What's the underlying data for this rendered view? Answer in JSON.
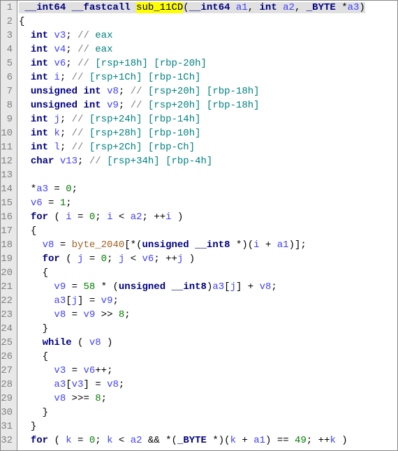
{
  "lines": [
    {
      "num": "1",
      "segments": [
        {
          "cls": "l1-highlight",
          "text": " "
        },
        {
          "cls": "type l1-highlight",
          "text": "__int64"
        },
        {
          "cls": "l1-highlight",
          "text": " "
        },
        {
          "cls": "kw l1-highlight",
          "text": "__fastcall"
        },
        {
          "cls": "l1-highlight",
          "text": " "
        },
        {
          "cls": "func-hl",
          "text": "sub_1"
        },
        {
          "cls": "func-hl",
          "text": "1CD"
        },
        {
          "cls": "paren l1-highlight",
          "text": "("
        },
        {
          "cls": "type l1-highlight",
          "text": "__int64"
        },
        {
          "cls": "l1-highlight",
          "text": " "
        },
        {
          "cls": "var l1-highlight",
          "text": "a1"
        },
        {
          "cls": "paren l1-highlight",
          "text": ", "
        },
        {
          "cls": "type l1-highlight",
          "text": "int"
        },
        {
          "cls": "l1-highlight",
          "text": " "
        },
        {
          "cls": "var l1-highlight",
          "text": "a2"
        },
        {
          "cls": "paren l1-highlight",
          "text": ", "
        },
        {
          "cls": "type l1-highlight",
          "text": "_BYTE"
        },
        {
          "cls": "l1-highlight",
          "text": " *"
        },
        {
          "cls": "var l1-highlight",
          "text": "a3"
        },
        {
          "cls": "paren l1-highlight",
          "text": ")"
        }
      ]
    },
    {
      "num": "2",
      "segments": [
        {
          "cls": "paren",
          "text": "{"
        }
      ]
    },
    {
      "num": "3",
      "segments": [
        {
          "cls": "text",
          "text": "  "
        },
        {
          "cls": "type",
          "text": "int"
        },
        {
          "cls": "text",
          "text": " "
        },
        {
          "cls": "var",
          "text": "v3"
        },
        {
          "cls": "paren",
          "text": "; "
        },
        {
          "cls": "comment",
          "text": "// "
        },
        {
          "cls": "reg",
          "text": "eax"
        }
      ]
    },
    {
      "num": "4",
      "segments": [
        {
          "cls": "text",
          "text": "  "
        },
        {
          "cls": "type",
          "text": "int"
        },
        {
          "cls": "text",
          "text": " "
        },
        {
          "cls": "var",
          "text": "v4"
        },
        {
          "cls": "paren",
          "text": "; "
        },
        {
          "cls": "comment",
          "text": "// "
        },
        {
          "cls": "reg",
          "text": "eax"
        }
      ]
    },
    {
      "num": "5",
      "segments": [
        {
          "cls": "text",
          "text": "  "
        },
        {
          "cls": "type",
          "text": "int"
        },
        {
          "cls": "text",
          "text": " "
        },
        {
          "cls": "var",
          "text": "v6"
        },
        {
          "cls": "paren",
          "text": "; "
        },
        {
          "cls": "comment",
          "text": "// "
        },
        {
          "cls": "reg",
          "text": "[rsp+18h] [rbp-20h]"
        }
      ]
    },
    {
      "num": "6",
      "segments": [
        {
          "cls": "text",
          "text": "  "
        },
        {
          "cls": "type",
          "text": "int"
        },
        {
          "cls": "text",
          "text": " "
        },
        {
          "cls": "var",
          "text": "i"
        },
        {
          "cls": "paren",
          "text": "; "
        },
        {
          "cls": "comment",
          "text": "// "
        },
        {
          "cls": "reg",
          "text": "[rsp+1Ch] [rbp-1Ch]"
        }
      ]
    },
    {
      "num": "7",
      "segments": [
        {
          "cls": "text",
          "text": "  "
        },
        {
          "cls": "type",
          "text": "unsigned"
        },
        {
          "cls": "text",
          "text": " "
        },
        {
          "cls": "type",
          "text": "int"
        },
        {
          "cls": "text",
          "text": " "
        },
        {
          "cls": "var",
          "text": "v8"
        },
        {
          "cls": "paren",
          "text": "; "
        },
        {
          "cls": "comment",
          "text": "// "
        },
        {
          "cls": "reg",
          "text": "[rsp+20h] [rbp-18h]"
        }
      ]
    },
    {
      "num": "8",
      "segments": [
        {
          "cls": "text",
          "text": "  "
        },
        {
          "cls": "type",
          "text": "unsigned"
        },
        {
          "cls": "text",
          "text": " "
        },
        {
          "cls": "type",
          "text": "int"
        },
        {
          "cls": "text",
          "text": " "
        },
        {
          "cls": "var",
          "text": "v9"
        },
        {
          "cls": "paren",
          "text": "; "
        },
        {
          "cls": "comment",
          "text": "// "
        },
        {
          "cls": "reg",
          "text": "[rsp+20h] [rbp-18h]"
        }
      ]
    },
    {
      "num": "9",
      "segments": [
        {
          "cls": "text",
          "text": "  "
        },
        {
          "cls": "type",
          "text": "int"
        },
        {
          "cls": "text",
          "text": " "
        },
        {
          "cls": "var",
          "text": "j"
        },
        {
          "cls": "paren",
          "text": "; "
        },
        {
          "cls": "comment",
          "text": "// "
        },
        {
          "cls": "reg",
          "text": "[rsp+24h] [rbp-14h]"
        }
      ]
    },
    {
      "num": "10",
      "segments": [
        {
          "cls": "text",
          "text": "  "
        },
        {
          "cls": "type",
          "text": "int"
        },
        {
          "cls": "text",
          "text": " "
        },
        {
          "cls": "var",
          "text": "k"
        },
        {
          "cls": "paren",
          "text": "; "
        },
        {
          "cls": "comment",
          "text": "// "
        },
        {
          "cls": "reg",
          "text": "[rsp+28h] [rbp-10h]"
        }
      ]
    },
    {
      "num": "11",
      "segments": [
        {
          "cls": "text",
          "text": "  "
        },
        {
          "cls": "type",
          "text": "int"
        },
        {
          "cls": "text",
          "text": " "
        },
        {
          "cls": "var",
          "text": "l"
        },
        {
          "cls": "paren",
          "text": "; "
        },
        {
          "cls": "comment",
          "text": "// "
        },
        {
          "cls": "reg",
          "text": "[rsp+2Ch] [rbp-Ch]"
        }
      ]
    },
    {
      "num": "12",
      "segments": [
        {
          "cls": "text",
          "text": "  "
        },
        {
          "cls": "type",
          "text": "char"
        },
        {
          "cls": "text",
          "text": " "
        },
        {
          "cls": "var",
          "text": "v13"
        },
        {
          "cls": "paren",
          "text": "; "
        },
        {
          "cls": "comment",
          "text": "// "
        },
        {
          "cls": "reg",
          "text": "[rsp+34h] [rbp-4h]"
        }
      ]
    },
    {
      "num": "13",
      "segments": []
    },
    {
      "num": "14",
      "segments": [
        {
          "cls": "text",
          "text": "  *"
        },
        {
          "cls": "var",
          "text": "a3"
        },
        {
          "cls": "text",
          "text": " = "
        },
        {
          "cls": "num",
          "text": "0"
        },
        {
          "cls": "paren",
          "text": ";"
        }
      ]
    },
    {
      "num": "15",
      "segments": [
        {
          "cls": "text",
          "text": "  "
        },
        {
          "cls": "var",
          "text": "v6"
        },
        {
          "cls": "text",
          "text": " = "
        },
        {
          "cls": "num",
          "text": "1"
        },
        {
          "cls": "paren",
          "text": ";"
        }
      ]
    },
    {
      "num": "16",
      "segments": [
        {
          "cls": "text",
          "text": "  "
        },
        {
          "cls": "kw",
          "text": "for"
        },
        {
          "cls": "text",
          "text": " "
        },
        {
          "cls": "paren",
          "text": "( "
        },
        {
          "cls": "var",
          "text": "i"
        },
        {
          "cls": "text",
          "text": " = "
        },
        {
          "cls": "num",
          "text": "0"
        },
        {
          "cls": "paren",
          "text": "; "
        },
        {
          "cls": "var",
          "text": "i"
        },
        {
          "cls": "text",
          "text": " < "
        },
        {
          "cls": "var",
          "text": "a2"
        },
        {
          "cls": "paren",
          "text": "; ++"
        },
        {
          "cls": "var",
          "text": "i"
        },
        {
          "cls": "paren",
          "text": " )"
        }
      ]
    },
    {
      "num": "17",
      "segments": [
        {
          "cls": "text",
          "text": "  "
        },
        {
          "cls": "paren",
          "text": "{"
        }
      ]
    },
    {
      "num": "18",
      "segments": [
        {
          "cls": "text",
          "text": "    "
        },
        {
          "cls": "var",
          "text": "v8"
        },
        {
          "cls": "text",
          "text": " = "
        },
        {
          "cls": "global",
          "text": "byte_2040"
        },
        {
          "cls": "paren",
          "text": "[*("
        },
        {
          "cls": "type",
          "text": "unsigned"
        },
        {
          "cls": "text",
          "text": " "
        },
        {
          "cls": "type",
          "text": "__int8"
        },
        {
          "cls": "text",
          "text": " *"
        },
        {
          "cls": "paren",
          "text": ")("
        },
        {
          "cls": "var",
          "text": "i"
        },
        {
          "cls": "text",
          "text": " + "
        },
        {
          "cls": "var",
          "text": "a1"
        },
        {
          "cls": "paren",
          "text": ")];"
        }
      ]
    },
    {
      "num": "19",
      "segments": [
        {
          "cls": "text",
          "text": "    "
        },
        {
          "cls": "kw",
          "text": "for"
        },
        {
          "cls": "text",
          "text": " "
        },
        {
          "cls": "paren",
          "text": "( "
        },
        {
          "cls": "var",
          "text": "j"
        },
        {
          "cls": "text",
          "text": " = "
        },
        {
          "cls": "num",
          "text": "0"
        },
        {
          "cls": "paren",
          "text": "; "
        },
        {
          "cls": "var",
          "text": "j"
        },
        {
          "cls": "text",
          "text": " < "
        },
        {
          "cls": "var",
          "text": "v6"
        },
        {
          "cls": "paren",
          "text": "; ++"
        },
        {
          "cls": "var",
          "text": "j"
        },
        {
          "cls": "paren",
          "text": " )"
        }
      ]
    },
    {
      "num": "20",
      "segments": [
        {
          "cls": "text",
          "text": "    "
        },
        {
          "cls": "paren",
          "text": "{"
        }
      ]
    },
    {
      "num": "21",
      "segments": [
        {
          "cls": "text",
          "text": "      "
        },
        {
          "cls": "var",
          "text": "v9"
        },
        {
          "cls": "text",
          "text": " = "
        },
        {
          "cls": "num",
          "text": "58"
        },
        {
          "cls": "text",
          "text": " * "
        },
        {
          "cls": "paren",
          "text": "("
        },
        {
          "cls": "type",
          "text": "unsigned"
        },
        {
          "cls": "text",
          "text": " "
        },
        {
          "cls": "type",
          "text": "__int8"
        },
        {
          "cls": "paren",
          "text": ")"
        },
        {
          "cls": "var",
          "text": "a3"
        },
        {
          "cls": "paren",
          "text": "["
        },
        {
          "cls": "var",
          "text": "j"
        },
        {
          "cls": "paren",
          "text": "]"
        },
        {
          "cls": "text",
          "text": " + "
        },
        {
          "cls": "var",
          "text": "v8"
        },
        {
          "cls": "paren",
          "text": ";"
        }
      ]
    },
    {
      "num": "22",
      "segments": [
        {
          "cls": "text",
          "text": "      "
        },
        {
          "cls": "var",
          "text": "a3"
        },
        {
          "cls": "paren",
          "text": "["
        },
        {
          "cls": "var",
          "text": "j"
        },
        {
          "cls": "paren",
          "text": "]"
        },
        {
          "cls": "text",
          "text": " = "
        },
        {
          "cls": "var",
          "text": "v9"
        },
        {
          "cls": "paren",
          "text": ";"
        }
      ]
    },
    {
      "num": "23",
      "segments": [
        {
          "cls": "text",
          "text": "      "
        },
        {
          "cls": "var",
          "text": "v8"
        },
        {
          "cls": "text",
          "text": " = "
        },
        {
          "cls": "var",
          "text": "v9"
        },
        {
          "cls": "text",
          "text": " >> "
        },
        {
          "cls": "num",
          "text": "8"
        },
        {
          "cls": "paren",
          "text": ";"
        }
      ]
    },
    {
      "num": "24",
      "segments": [
        {
          "cls": "text",
          "text": "    "
        },
        {
          "cls": "paren",
          "text": "}"
        }
      ]
    },
    {
      "num": "25",
      "segments": [
        {
          "cls": "text",
          "text": "    "
        },
        {
          "cls": "kw",
          "text": "while"
        },
        {
          "cls": "text",
          "text": " "
        },
        {
          "cls": "paren",
          "text": "( "
        },
        {
          "cls": "var",
          "text": "v8"
        },
        {
          "cls": "paren",
          "text": " )"
        }
      ]
    },
    {
      "num": "26",
      "segments": [
        {
          "cls": "text",
          "text": "    "
        },
        {
          "cls": "paren",
          "text": "{"
        }
      ]
    },
    {
      "num": "27",
      "segments": [
        {
          "cls": "text",
          "text": "      "
        },
        {
          "cls": "var",
          "text": "v3"
        },
        {
          "cls": "text",
          "text": " = "
        },
        {
          "cls": "var",
          "text": "v6"
        },
        {
          "cls": "text",
          "text": "++"
        },
        {
          "cls": "paren",
          "text": ";"
        }
      ]
    },
    {
      "num": "28",
      "segments": [
        {
          "cls": "text",
          "text": "      "
        },
        {
          "cls": "var",
          "text": "a3"
        },
        {
          "cls": "paren",
          "text": "["
        },
        {
          "cls": "var",
          "text": "v3"
        },
        {
          "cls": "paren",
          "text": "]"
        },
        {
          "cls": "text",
          "text": " = "
        },
        {
          "cls": "var",
          "text": "v8"
        },
        {
          "cls": "paren",
          "text": ";"
        }
      ]
    },
    {
      "num": "29",
      "segments": [
        {
          "cls": "text",
          "text": "      "
        },
        {
          "cls": "var",
          "text": "v8"
        },
        {
          "cls": "text",
          "text": " >>= "
        },
        {
          "cls": "num",
          "text": "8"
        },
        {
          "cls": "paren",
          "text": ";"
        }
      ]
    },
    {
      "num": "30",
      "segments": [
        {
          "cls": "text",
          "text": "    "
        },
        {
          "cls": "paren",
          "text": "}"
        }
      ]
    },
    {
      "num": "31",
      "segments": [
        {
          "cls": "text",
          "text": "  "
        },
        {
          "cls": "paren",
          "text": "}"
        }
      ]
    },
    {
      "num": "32",
      "segments": [
        {
          "cls": "text",
          "text": "  "
        },
        {
          "cls": "kw",
          "text": "for"
        },
        {
          "cls": "text",
          "text": " "
        },
        {
          "cls": "paren",
          "text": "( "
        },
        {
          "cls": "var",
          "text": "k"
        },
        {
          "cls": "text",
          "text": " = "
        },
        {
          "cls": "num",
          "text": "0"
        },
        {
          "cls": "paren",
          "text": "; "
        },
        {
          "cls": "var",
          "text": "k"
        },
        {
          "cls": "text",
          "text": " < "
        },
        {
          "cls": "var",
          "text": "a2"
        },
        {
          "cls": "text",
          "text": " && *"
        },
        {
          "cls": "paren",
          "text": "("
        },
        {
          "cls": "type",
          "text": "_BYTE"
        },
        {
          "cls": "text",
          "text": " *"
        },
        {
          "cls": "paren",
          "text": ")("
        },
        {
          "cls": "var",
          "text": "k"
        },
        {
          "cls": "text",
          "text": " + "
        },
        {
          "cls": "var",
          "text": "a1"
        },
        {
          "cls": "paren",
          "text": ")"
        },
        {
          "cls": "text",
          "text": " == "
        },
        {
          "cls": "num",
          "text": "49"
        },
        {
          "cls": "paren",
          "text": "; ++"
        },
        {
          "cls": "var",
          "text": "k"
        },
        {
          "cls": "paren",
          "text": " )"
        }
      ]
    }
  ]
}
